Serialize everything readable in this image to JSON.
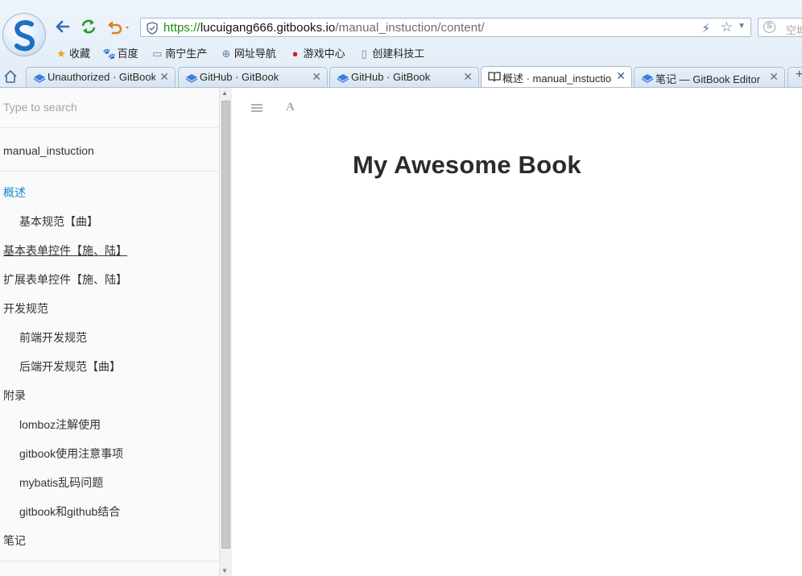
{
  "browser": {
    "address_bar": {
      "scheme": "https://",
      "host": "lucuigang666.gitbooks.io",
      "path": "/manual_instuction/content/"
    },
    "search_placeholder": "空城",
    "bookmarks": [
      {
        "label": "收藏",
        "icon": "star-icon"
      },
      {
        "label": "百度",
        "icon": "baidu-paw-icon"
      },
      {
        "label": "南宁生产",
        "icon": "folder-icon"
      },
      {
        "label": "网址导航",
        "icon": "globe-icon"
      },
      {
        "label": "游戏中心",
        "icon": "game-icon"
      },
      {
        "label": "创建科技工",
        "icon": "page-icon"
      }
    ],
    "tabs": [
      {
        "label": "Unauthorized · GitBook",
        "icon": "gitbook-icon",
        "active": false
      },
      {
        "label": "GitHub · GitBook",
        "icon": "gitbook-icon",
        "active": false
      },
      {
        "label": "GitHub · GitBook",
        "icon": "gitbook-icon",
        "active": false
      },
      {
        "label": "概述 · manual_instuction",
        "icon": "book-icon",
        "active": true
      },
      {
        "label": "笔记 — GitBook Editor",
        "icon": "gitbook-icon",
        "active": false
      }
    ],
    "new_tab_label": "+"
  },
  "sidebar": {
    "search_placeholder": "Type to search",
    "book_name": "manual_instuction",
    "toc": [
      {
        "label": "概述",
        "level": 0,
        "state": "active"
      },
      {
        "label": "基本规范【曲】",
        "level": 1,
        "state": ""
      },
      {
        "label": "基本表单控件【施、陆】",
        "level": 0,
        "state": "hover"
      },
      {
        "label": "扩展表单控件【施、陆】",
        "level": 0,
        "state": ""
      },
      {
        "label": "开发规范",
        "level": 0,
        "state": ""
      },
      {
        "label": "前端开发规范",
        "level": 1,
        "state": ""
      },
      {
        "label": "后端开发规范【曲】",
        "level": 1,
        "state": ""
      },
      {
        "label": "附录",
        "level": 0,
        "state": ""
      },
      {
        "label": "lomboz注解使用",
        "level": 1,
        "state": ""
      },
      {
        "label": "gitbook使用注意事项",
        "level": 1,
        "state": ""
      },
      {
        "label": "mybatis乱码问题",
        "level": 1,
        "state": ""
      },
      {
        "label": "gitbook和github结合",
        "level": 1,
        "state": ""
      },
      {
        "label": "笔记",
        "level": 0,
        "state": ""
      }
    ]
  },
  "content": {
    "title": "My Awesome Book",
    "font_button_label": "A"
  },
  "colors": {
    "active_link": "#1a8ad1",
    "https_green": "#1b8a1b",
    "chrome_bg": "#e2ecf7"
  }
}
